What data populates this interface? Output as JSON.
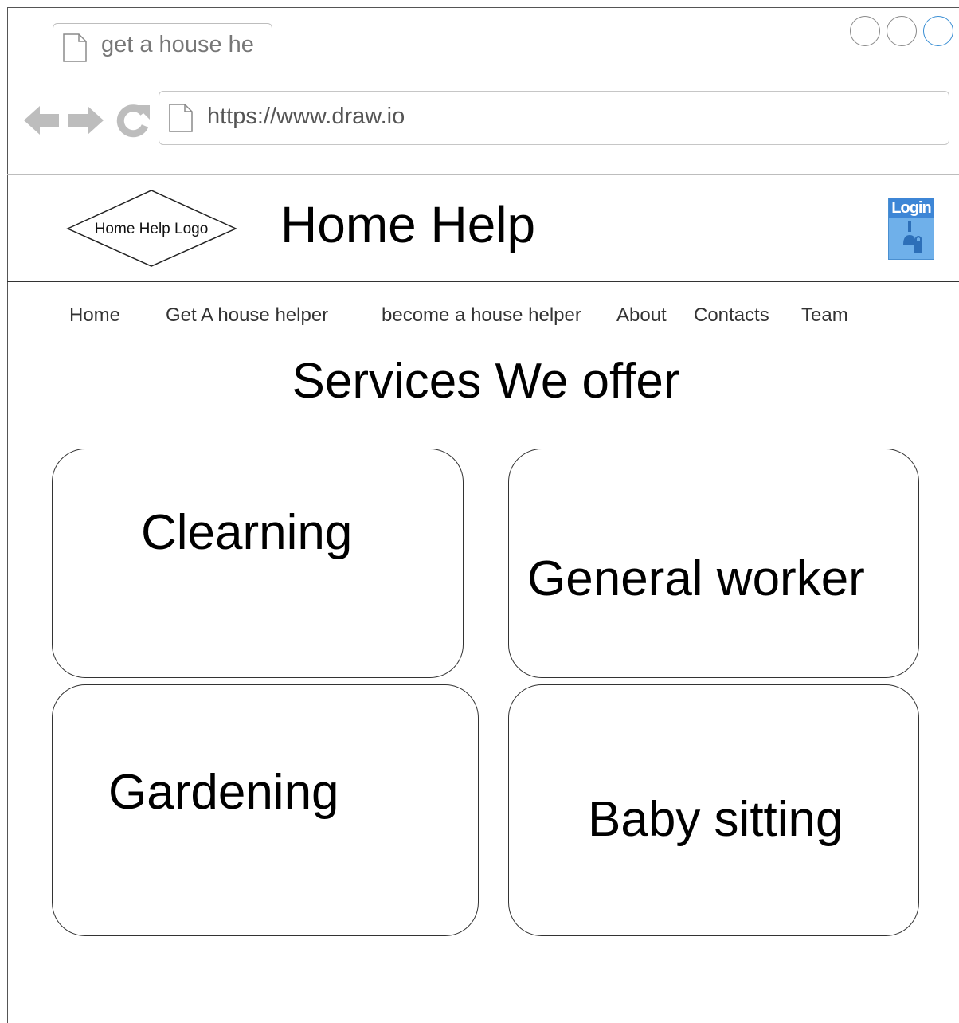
{
  "browser": {
    "tab_title": "get a house he",
    "url": "https://www.draw.io",
    "icons": [
      "page-icon",
      "back-arrow-icon",
      "forward-arrow-icon",
      "reload-icon"
    ]
  },
  "header": {
    "logo_label": "Home Help Logo",
    "title": "Home Help",
    "login_label": "Login"
  },
  "nav": {
    "items": [
      "Home",
      "Get A house helper",
      "become a house helper",
      "About",
      "Contacts",
      "Team"
    ]
  },
  "services": {
    "heading": "Services We offer",
    "cards": [
      "Clearning",
      "General worker",
      "Gardening",
      "Baby sitting"
    ]
  }
}
